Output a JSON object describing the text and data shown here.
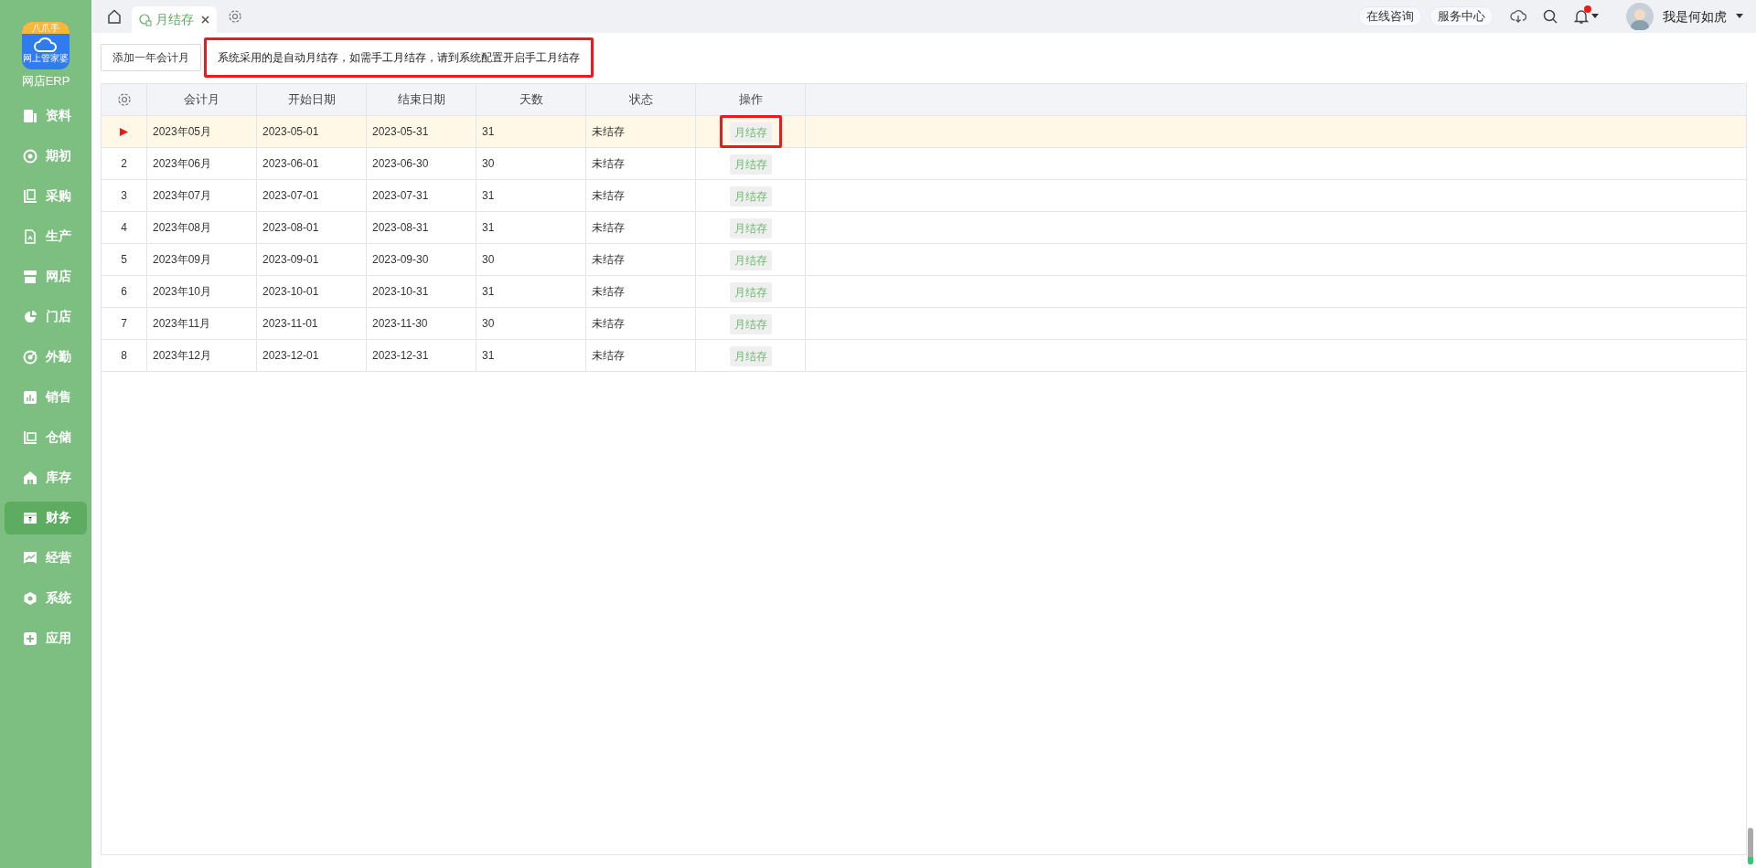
{
  "sidebar": {
    "logo_badge": "八爪手",
    "logo_caption": "网上管家婆",
    "app_name": "网店ERP",
    "items": [
      {
        "label": "资料",
        "selected": false
      },
      {
        "label": "期初",
        "selected": false
      },
      {
        "label": "采购",
        "selected": false
      },
      {
        "label": "生产",
        "selected": false
      },
      {
        "label": "网店",
        "selected": false
      },
      {
        "label": "门店",
        "selected": false
      },
      {
        "label": "外勤",
        "selected": false
      },
      {
        "label": "销售",
        "selected": false
      },
      {
        "label": "仓储",
        "selected": false
      },
      {
        "label": "库存",
        "selected": false
      },
      {
        "label": "财务",
        "selected": true
      },
      {
        "label": "经营",
        "selected": false
      },
      {
        "label": "系统",
        "selected": false
      },
      {
        "label": "应用",
        "selected": false
      }
    ]
  },
  "tabs": [
    {
      "label": "月结存",
      "selected": true
    }
  ],
  "header": {
    "links": [
      "在线咨询",
      "服务中心"
    ],
    "notification_dot": true,
    "user_name": "我是何如虎"
  },
  "toolbar": {
    "add_button": "添加一年会计月",
    "notice": {
      "text": "系统采用的是自动月结存，如需手工月结存，请到系统配置开启手工月结存",
      "highlighted": true
    }
  },
  "table": {
    "columns": [
      "会计月",
      "开始日期",
      "结束日期",
      "天数",
      "状态",
      "操作"
    ],
    "rows": [
      {
        "selected": true,
        "month": "2023年05月",
        "start": "2023-05-01",
        "end": "2023-05-31",
        "days": "31",
        "status": "未结存",
        "action": "月结存",
        "highlighted": true
      },
      {
        "selected": false,
        "number": "2",
        "month": "2023年06月",
        "start": "2023-06-01",
        "end": "2023-06-30",
        "days": "30",
        "status": "未结存",
        "action": "月结存",
        "highlighted": false
      },
      {
        "selected": false,
        "number": "3",
        "month": "2023年07月",
        "start": "2023-07-01",
        "end": "2023-07-31",
        "days": "31",
        "status": "未结存",
        "action": "月结存",
        "highlighted": false
      },
      {
        "selected": false,
        "number": "4",
        "month": "2023年08月",
        "start": "2023-08-01",
        "end": "2023-08-31",
        "days": "31",
        "status": "未结存",
        "action": "月结存",
        "highlighted": false
      },
      {
        "selected": false,
        "number": "5",
        "month": "2023年09月",
        "start": "2023-09-01",
        "end": "2023-09-30",
        "days": "30",
        "status": "未结存",
        "action": "月结存",
        "highlighted": false
      },
      {
        "selected": false,
        "number": "6",
        "month": "2023年10月",
        "start": "2023-10-01",
        "end": "2023-10-31",
        "days": "31",
        "status": "未结存",
        "action": "月结存",
        "highlighted": false
      },
      {
        "selected": false,
        "number": "7",
        "month": "2023年11月",
        "start": "2023-11-01",
        "end": "2023-11-30",
        "days": "30",
        "status": "未结存",
        "action": "月结存",
        "highlighted": false
      },
      {
        "selected": false,
        "number": "8",
        "month": "2023年12月",
        "start": "2023-12-01",
        "end": "2023-12-31",
        "days": "31",
        "status": "未结存",
        "action": "月结存",
        "highlighted": false
      }
    ]
  }
}
